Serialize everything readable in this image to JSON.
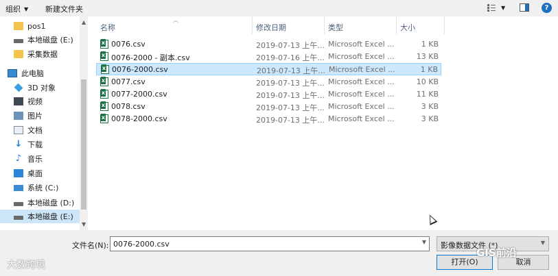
{
  "toolbar": {
    "organize_label": "组织",
    "new_folder_label": "新建文件夹",
    "view_icon": "view-options-icon",
    "preview_icon": "preview-pane-icon",
    "help_icon": "help-icon",
    "help_glyph": "?"
  },
  "nav": {
    "items": [
      {
        "label": "pos1",
        "icon": "folder-icon"
      },
      {
        "label": "本地磁盘 (E:)",
        "icon": "drive-icon"
      },
      {
        "label": "采集数据",
        "icon": "folder-icon"
      },
      {
        "label": "此电脑",
        "icon": "computer-icon"
      },
      {
        "label": "3D 对象",
        "icon": "3d-objects-icon"
      },
      {
        "label": "视频",
        "icon": "video-icon"
      },
      {
        "label": "图片",
        "icon": "pictures-icon"
      },
      {
        "label": "文档",
        "icon": "documents-icon"
      },
      {
        "label": "下载",
        "icon": "download-icon"
      },
      {
        "label": "音乐",
        "icon": "music-icon"
      },
      {
        "label": "桌面",
        "icon": "desktop-icon"
      },
      {
        "label": "系统 (C:)",
        "icon": "system-drive-icon"
      },
      {
        "label": "本地磁盘 (D:)",
        "icon": "drive-icon"
      },
      {
        "label": "本地磁盘 (E:)",
        "icon": "drive-icon"
      }
    ]
  },
  "columns": {
    "name": "名称",
    "date": "修改日期",
    "type": "类型",
    "size": "大小"
  },
  "files": [
    {
      "name": "0076.csv",
      "date": "2019-07-13 上午...",
      "type": "Microsoft Excel ...",
      "size": "1 KB"
    },
    {
      "name": "0076-2000 - 副本.csv",
      "date": "2019-07-16 上午...",
      "type": "Microsoft Excel ...",
      "size": "13 KB"
    },
    {
      "name": "0076-2000.csv",
      "date": "2019-07-13 上午...",
      "type": "Microsoft Excel ...",
      "size": "1 KB"
    },
    {
      "name": "0077.csv",
      "date": "2019-07-13 上午...",
      "type": "Microsoft Excel ...",
      "size": "10 KB"
    },
    {
      "name": "0077-2000.csv",
      "date": "2019-07-13 上午...",
      "type": "Microsoft Excel ...",
      "size": "11 KB"
    },
    {
      "name": "0078.csv",
      "date": "2019-07-13 上午...",
      "type": "Microsoft Excel ...",
      "size": "3 KB"
    },
    {
      "name": "0078-2000.csv",
      "date": "2019-07-13 上午...",
      "type": "Microsoft Excel ...",
      "size": "3 KB"
    }
  ],
  "selected_file": "0076-2000.csv",
  "bottom": {
    "filename_label": "文件名(N):",
    "filename_value": "0076-2000.csv",
    "filter_value": "影像数据文件 (*)",
    "open_label": "打开(O)",
    "cancel_label": "取消"
  },
  "watermarks": {
    "left": "大数跨境",
    "right": "GIS前沿"
  }
}
